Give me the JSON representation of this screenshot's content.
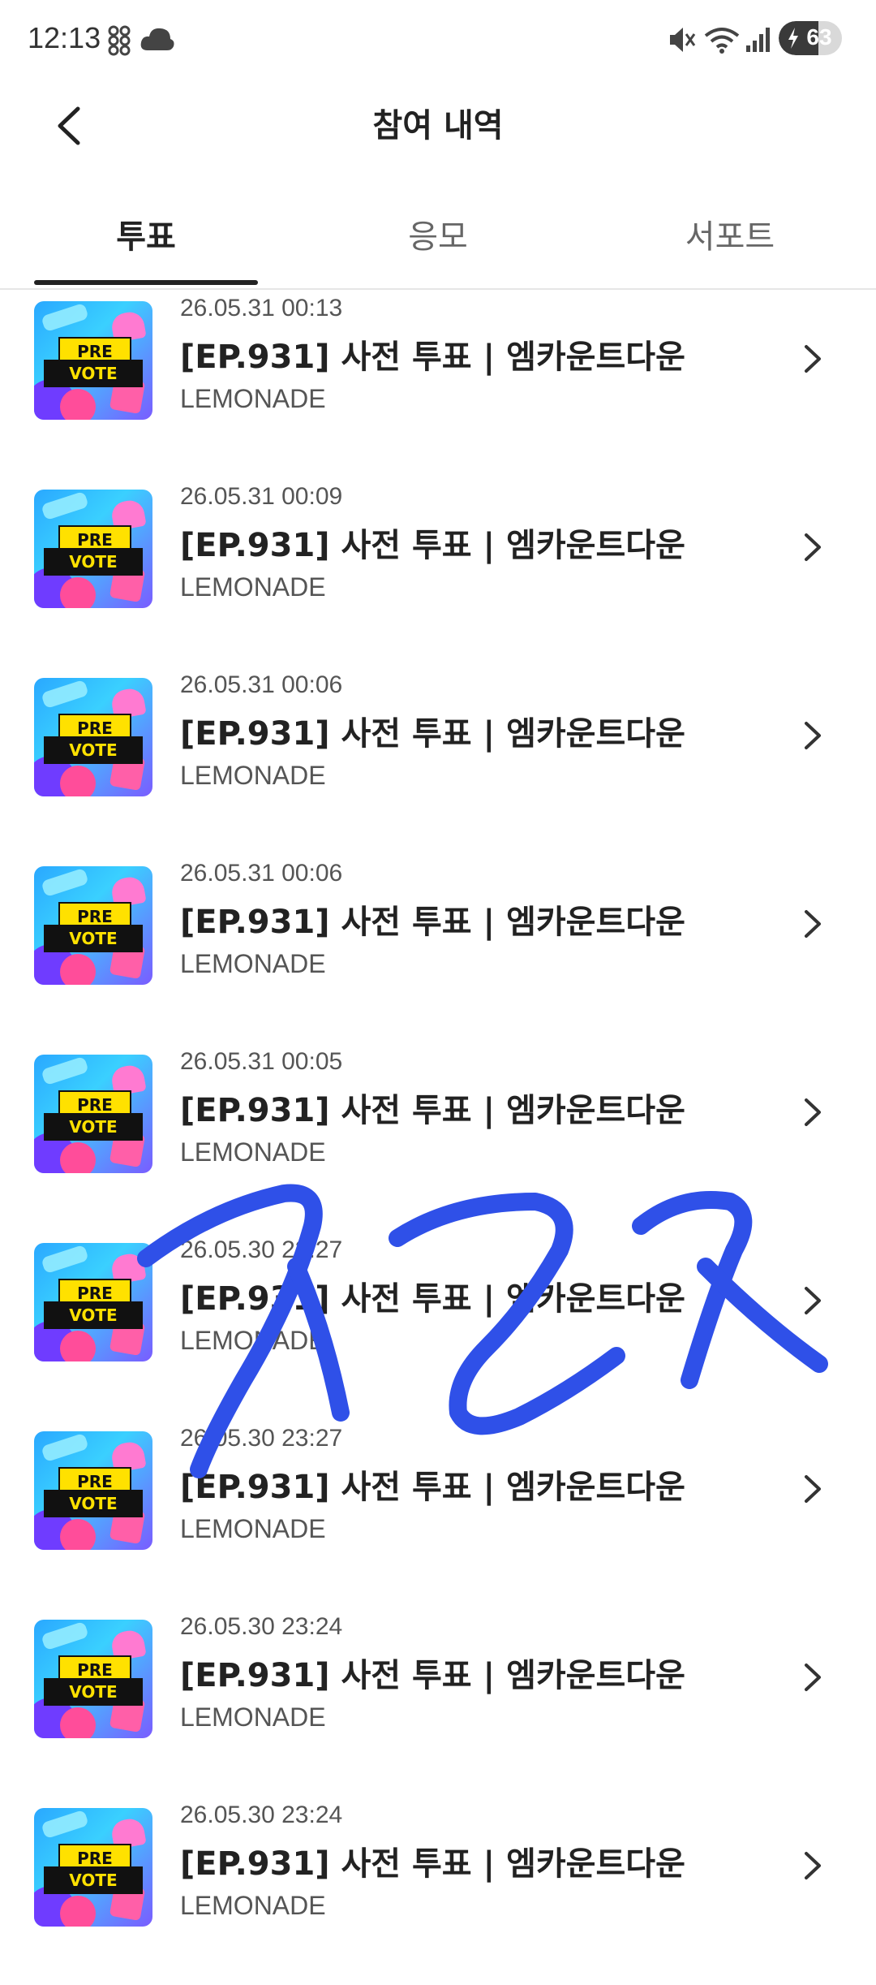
{
  "status_bar": {
    "time": "12:13",
    "battery_level": "63",
    "icons": [
      "grid-app-icon",
      "cloud-icon",
      "mute-icon",
      "wifi-icon",
      "signal-icon",
      "battery-icon"
    ]
  },
  "header": {
    "title": "참여 내역",
    "back_icon": "chevron-left-icon"
  },
  "tabs": [
    {
      "label": "투표",
      "active": true
    },
    {
      "label": "응모",
      "active": false
    },
    {
      "label": "서포트",
      "active": false
    }
  ],
  "thumbnail": {
    "top_text": "PRE",
    "bottom_text": "VOTE"
  },
  "items": [
    {
      "date": "26.05.31 00:13",
      "title": "[EP.931] 사전 투표 | 엠카운트다운",
      "subtitle": "LEMONADE"
    },
    {
      "date": "26.05.31 00:09",
      "title": "[EP.931] 사전 투표 | 엠카운트다운",
      "subtitle": "LEMONADE"
    },
    {
      "date": "26.05.31 00:06",
      "title": "[EP.931] 사전 투표 | 엠카운트다운",
      "subtitle": "LEMONADE"
    },
    {
      "date": "26.05.31 00:06",
      "title": "[EP.931] 사전 투표 | 엠카운트다운",
      "subtitle": "LEMONADE"
    },
    {
      "date": "26.05.31 00:05",
      "title": "[EP.931] 사전 투표 | 엠카운트다운",
      "subtitle": "LEMONADE"
    },
    {
      "date": "26.05.30 23:27",
      "title": "[EP.931] 사전 투표 | 엠카운트다운",
      "subtitle": "LEMONADE"
    },
    {
      "date": "26.05.30 23:27",
      "title": "[EP.931] 사전 투표 | 엠카운트다운",
      "subtitle": "LEMONADE"
    },
    {
      "date": "26.05.30 23:24",
      "title": "[EP.931] 사전 투표 | 엠카운트다운",
      "subtitle": "LEMONADE"
    },
    {
      "date": "26.05.30 23:24",
      "title": "[EP.931] 사전 투표 | 엠카운트다운",
      "subtitle": "LEMONADE"
    }
  ],
  "colors": {
    "accent": "#222222",
    "scribble": "#2f50e8"
  }
}
